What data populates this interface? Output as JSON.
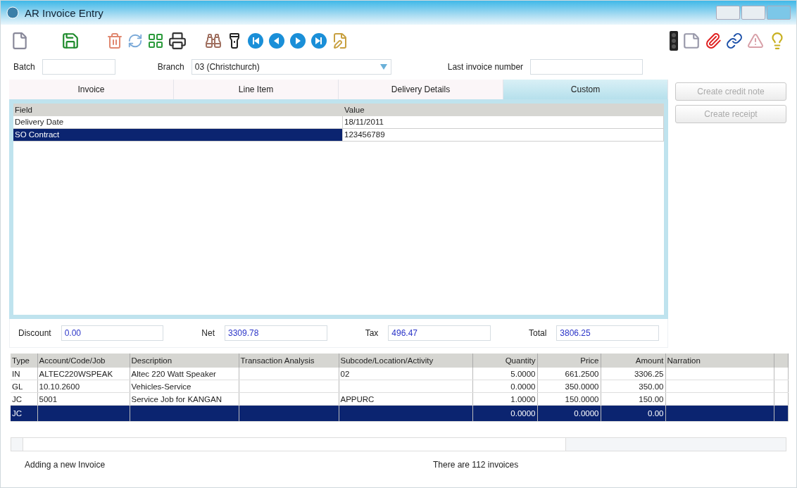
{
  "window": {
    "title": "AR Invoice Entry"
  },
  "header": {
    "batch": {
      "label": "Batch"
    },
    "branch": {
      "label": "Branch",
      "value": "03  (Christchurch)"
    },
    "last_invoice_number": {
      "label": "Last invoice number"
    }
  },
  "tabs": [
    {
      "label": "Invoice",
      "selected": false
    },
    {
      "label": "Line Item",
      "selected": false
    },
    {
      "label": "Delivery Details",
      "selected": false
    },
    {
      "label": "Custom",
      "selected": true
    }
  ],
  "side_buttons": [
    {
      "label": "Create credit note",
      "disabled": true
    },
    {
      "label": "Create receipt",
      "disabled": true
    }
  ],
  "custom_fields": {
    "columns": [
      "Field",
      "Value"
    ],
    "rows": [
      {
        "field": "Delivery Date",
        "value": "18/11/2011",
        "selected": false
      },
      {
        "field": "SO Contract",
        "value": "123456789",
        "selected": true
      }
    ]
  },
  "totals": [
    {
      "label": "Discount",
      "value": "0.00"
    },
    {
      "label": "Net",
      "value": "3309.78"
    },
    {
      "label": "Tax",
      "value": "496.47"
    },
    {
      "label": "Total",
      "value": "3806.25"
    }
  ],
  "lines": {
    "columns": [
      "Type",
      "Account/Code/Job",
      "Description",
      "Transaction Analysis",
      "Subcode/Location/Activity",
      "Quantity",
      "Price",
      "Amount",
      "Narration"
    ],
    "rows": [
      {
        "cells": [
          "IN",
          "ALTEC220WSPEAK",
          "Altec 220 Watt Speaker",
          "",
          "02",
          "5.0000",
          "661.2500",
          "3306.25",
          ""
        ],
        "selected": false
      },
      {
        "cells": [
          "GL",
          "10.10.2600",
          "Vehicles-Service",
          "",
          "",
          "0.0000",
          "350.0000",
          "350.00",
          ""
        ],
        "selected": false
      },
      {
        "cells": [
          "JC",
          "5001",
          "Service Job for KANGAN",
          "",
          "APPURC",
          "1.0000",
          "150.0000",
          "150.00",
          ""
        ],
        "selected": false
      },
      {
        "cells": [
          "JC",
          "",
          "",
          "",
          "",
          "0.0000",
          "0.0000",
          "0.00",
          ""
        ],
        "selected": true
      }
    ]
  },
  "status_bar": {
    "left": "Adding a new Invoice",
    "right": "There are 112 invoices"
  }
}
